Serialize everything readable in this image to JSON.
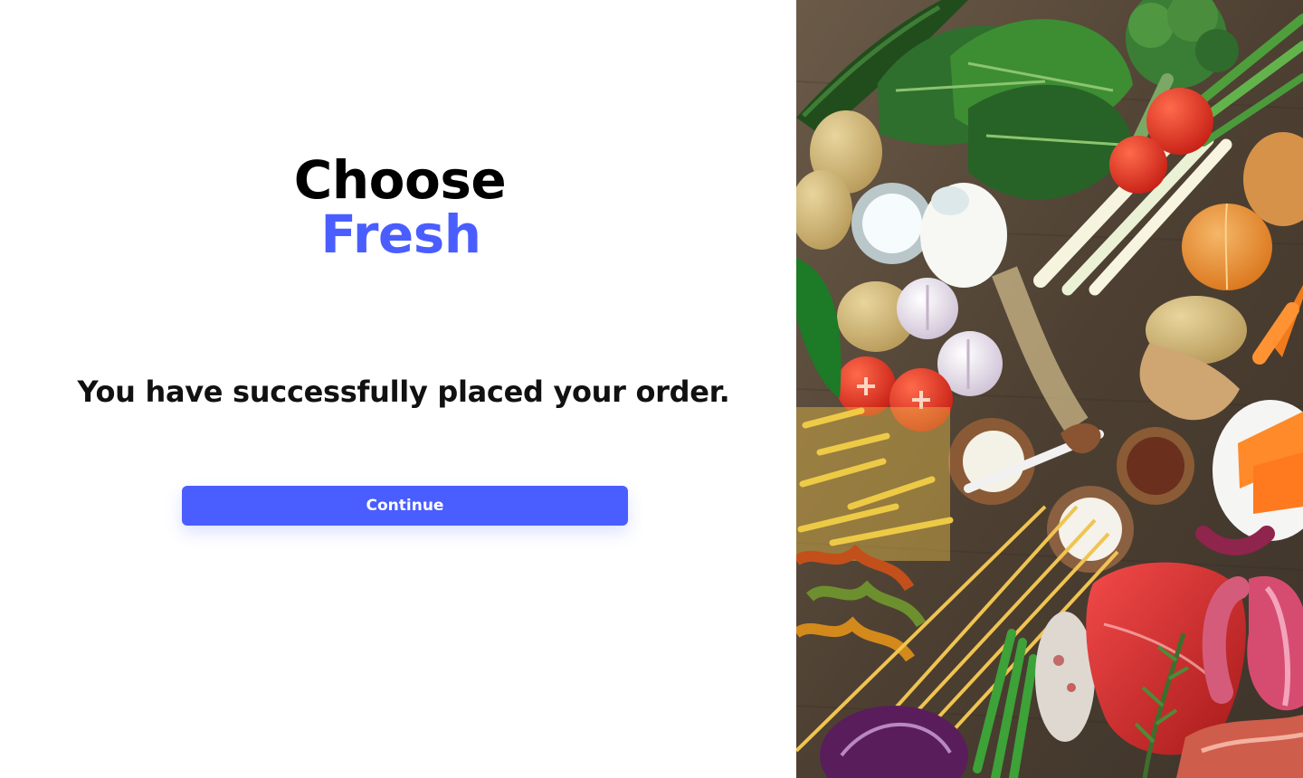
{
  "brand": {
    "line1": "Choose",
    "line2": "Fresh"
  },
  "confirmation": {
    "message": "You have successfully placed your order."
  },
  "actions": {
    "continue_label": "Continue"
  },
  "colors": {
    "accent": "#4a5eff",
    "text": "#000000",
    "button_text": "#ffffff"
  },
  "image": {
    "subject": "fresh groceries"
  }
}
